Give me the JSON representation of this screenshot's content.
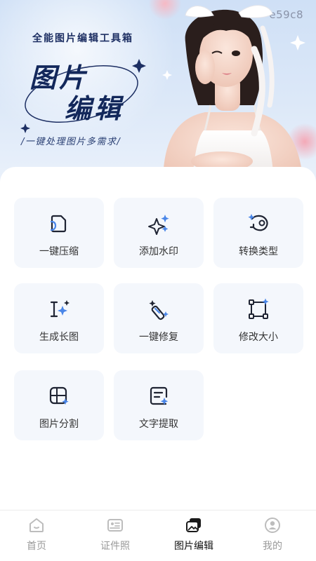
{
  "banner": {
    "code": "e59c8",
    "tagline": "全能图片编辑工具箱",
    "title_line1": "图片",
    "title_line2": "编辑",
    "subtitle": "/一键处理图片多需求/"
  },
  "tools": [
    {
      "label": "一键压缩",
      "icon": "compress-icon"
    },
    {
      "label": "添加水印",
      "icon": "sparkle-watermark-icon"
    },
    {
      "label": "转换类型",
      "icon": "convert-type-icon"
    },
    {
      "label": "生成长图",
      "icon": "text-cursor-sparkle-icon"
    },
    {
      "label": "一键修复",
      "icon": "magic-wand-icon"
    },
    {
      "label": "修改大小",
      "icon": "resize-icon"
    },
    {
      "label": "图片分割",
      "icon": "image-split-icon"
    },
    {
      "label": "文字提取",
      "icon": "text-extract-icon"
    }
  ],
  "tabbar": {
    "items": [
      {
        "label": "首页",
        "icon": "home-icon",
        "active": false
      },
      {
        "label": "证件照",
        "icon": "id-card-icon",
        "active": false
      },
      {
        "label": "图片编辑",
        "icon": "image-edit-icon",
        "active": true
      },
      {
        "label": "我的",
        "icon": "user-icon",
        "active": false
      }
    ]
  },
  "colors": {
    "accent_blue": "#4a86e8",
    "icon_dark": "#1f2433",
    "card_bg": "#f4f7fc",
    "title_navy": "#13285b"
  }
}
